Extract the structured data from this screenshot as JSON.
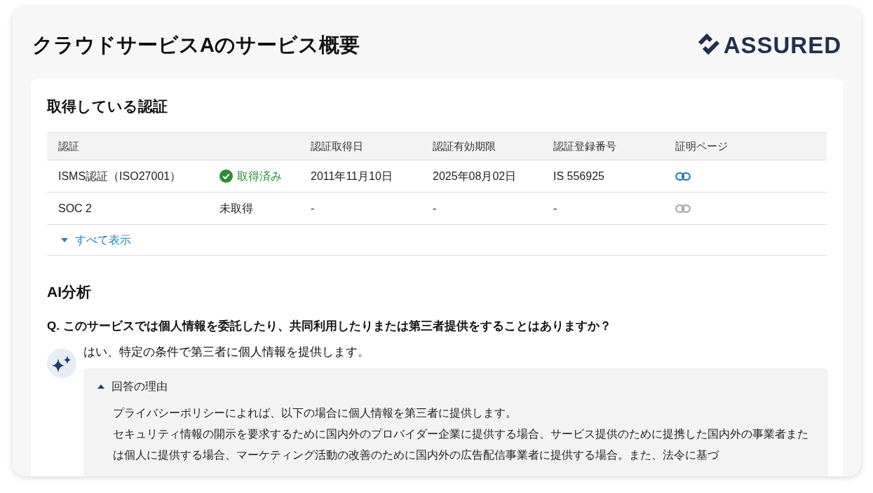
{
  "title": "クラウドサービスAのサービス概要",
  "logo": {
    "text": "ASSURED"
  },
  "certifications": {
    "heading": "取得している認証",
    "columns": {
      "certification": "認証",
      "acquired_on": "認証取得日",
      "expires_on": "認証有効期限",
      "registration_number": "認証登録番号",
      "proof_page": "証明ページ"
    },
    "rows": [
      {
        "name": "ISMS認証（ISO27001）",
        "status": {
          "acquired": true,
          "label": "取得済み"
        },
        "acquired_on": "2011年11月10日",
        "expires_on": "2025年08月02日",
        "registration_number": "IS 556925",
        "proof_link": {
          "enabled": true
        }
      },
      {
        "name": "SOC 2",
        "status": {
          "acquired": false,
          "label": "未取得"
        },
        "acquired_on": "-",
        "expires_on": "-",
        "registration_number": "-",
        "proof_link": {
          "enabled": false
        }
      }
    ],
    "show_all": {
      "label": "すべて表示",
      "expanded": false
    }
  },
  "ai_analysis": {
    "heading": "AI分析",
    "question": "Q. このサービスでは個人情報を委託したり、共同利用したりまたは第三者提供をすることはありますか？",
    "answer": "はい、特定の条件で第三者に個人情報を提供します。",
    "reason": {
      "label": "回答の理由",
      "expanded": true,
      "paragraphs": [
        "プライバシーポリシーによれば、以下の場合に個人情報を第三者に提供します。",
        "セキュリティ情報の開示を要求するために国内外のプロバイダー企業に提供する場合、サービス提供のために提携した国内外の事業者または個人に提供する場合、マーケティング活動の改善のために国内外の広告配信事業者に提供する場合。また、法令に基づ"
      ]
    }
  }
}
